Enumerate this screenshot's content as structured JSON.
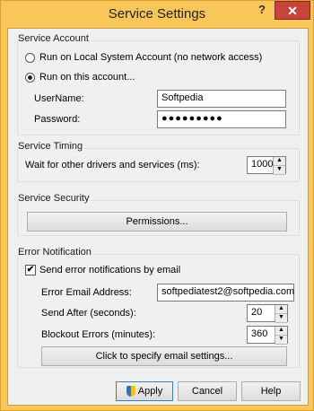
{
  "window": {
    "title": "Service Settings",
    "help_glyph": "?",
    "close_glyph": "✕"
  },
  "service_account": {
    "label": "Service Account",
    "local_system_label": "Run on Local System Account (no network access)",
    "this_account_label": "Run on this account...",
    "selected": "this_account",
    "username_label": "UserName:",
    "username_value": "Softpedia",
    "password_label": "Password:",
    "password_value": "●●●●●●●●●"
  },
  "service_timing": {
    "label": "Service Timing",
    "wait_label": "Wait for other drivers and services (ms):",
    "wait_value": "1000"
  },
  "service_security": {
    "label": "Service Security",
    "permissions_button": "Permissions..."
  },
  "error_notification": {
    "label": "Error Notification",
    "send_email_label": "Send error notifications by email",
    "send_email_checked": true,
    "check_glyph": "✔",
    "email_address_label": "Error Email Address:",
    "email_address_value": "softpediatest2@softpedia.com",
    "send_after_label": "Send After (seconds):",
    "send_after_value": "20",
    "blockout_label": "Blockout Errors (minutes):",
    "blockout_value": "360",
    "email_settings_button": "Click to specify email settings..."
  },
  "footer": {
    "apply_label": "Apply",
    "cancel_label": "Cancel",
    "help_label": "Help"
  },
  "spinner_glyphs": {
    "up": "▲",
    "down": "▼"
  },
  "colors": {
    "frame": "#f9c65a",
    "close": "#c7443a",
    "dialog_bg": "#f0f0f0"
  }
}
